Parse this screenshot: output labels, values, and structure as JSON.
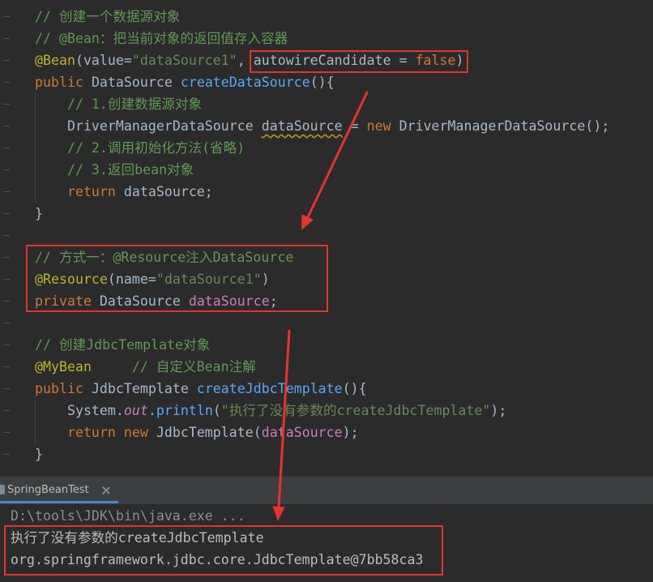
{
  "editor": {
    "lines": [
      {
        "tokens": [
          {
            "text": "// 创建一个数据源对象",
            "color": "#629755"
          }
        ]
      },
      {
        "tokens": [
          {
            "text": "// @Bean：把当前对象的返回值存入容器",
            "color": "#629755"
          }
        ]
      },
      {
        "tokens": [
          {
            "text": "@Bean",
            "color": "#BBB529"
          },
          {
            "text": "(value=",
            "color": "#A9B7C6"
          },
          {
            "text": "\"dataSource1\"",
            "color": "#6A8759"
          },
          {
            "text": ", autowireCandidate = ",
            "color": "#A9B7C6"
          },
          {
            "text": "false",
            "color": "#CC7832"
          },
          {
            "text": ")",
            "color": "#A9B7C6"
          }
        ]
      },
      {
        "tokens": [
          {
            "text": "public",
            "color": "#CC7832"
          },
          {
            "text": " DataSource ",
            "color": "#A9B7C6"
          },
          {
            "text": "createDataSource",
            "color": "#56A8F5"
          },
          {
            "text": "(){",
            "color": "#A9B7C6"
          }
        ]
      },
      {
        "tokens": [
          {
            "text": "    // 1.创建数据源对象",
            "color": "#629755"
          }
        ]
      },
      {
        "tokens": [
          {
            "text": "    DriverManagerDataSource ",
            "color": "#A9B7C6"
          },
          {
            "text": "dataSource",
            "color": "#A9B7C6",
            "wavy": true
          },
          {
            "text": " = ",
            "color": "#A9B7C6"
          },
          {
            "text": "new",
            "color": "#CC7832"
          },
          {
            "text": " DriverManagerDataSource();",
            "color": "#A9B7C6"
          }
        ]
      },
      {
        "tokens": [
          {
            "text": "    // 2.调用初始化方法(省略)",
            "color": "#629755"
          }
        ]
      },
      {
        "tokens": [
          {
            "text": "    // 3.返回bean对象",
            "color": "#629755"
          }
        ]
      },
      {
        "tokens": [
          {
            "text": "    return",
            "color": "#CC7832"
          },
          {
            "text": " dataSource;",
            "color": "#A9B7C6"
          }
        ]
      },
      {
        "tokens": [
          {
            "text": "}",
            "color": "#A9B7C6"
          }
        ]
      },
      {
        "tokens": []
      },
      {
        "tokens": [
          {
            "text": "// 方式一：@Resource注入DataSource",
            "color": "#629755"
          }
        ]
      },
      {
        "tokens": [
          {
            "text": "@Resource",
            "color": "#BBB529"
          },
          {
            "text": "(name=",
            "color": "#A9B7C6"
          },
          {
            "text": "\"dataSource1\"",
            "color": "#6A8759"
          },
          {
            "text": ")",
            "color": "#A9B7C6"
          }
        ]
      },
      {
        "tokens": [
          {
            "text": "private",
            "color": "#CC7832"
          },
          {
            "text": " DataSource ",
            "color": "#A9B7C6"
          },
          {
            "text": "dataSource",
            "color": "#C77DBB"
          },
          {
            "text": ";",
            "color": "#A9B7C6"
          }
        ]
      },
      {
        "tokens": []
      },
      {
        "tokens": [
          {
            "text": "// 创建JdbcTemplate对象",
            "color": "#629755"
          }
        ]
      },
      {
        "tokens": [
          {
            "text": "@MyBean",
            "color": "#BBB529"
          },
          {
            "text": "     // 自定义Bean注解",
            "color": "#629755"
          }
        ]
      },
      {
        "tokens": [
          {
            "text": "public",
            "color": "#CC7832"
          },
          {
            "text": " JdbcTemplate ",
            "color": "#A9B7C6"
          },
          {
            "text": "createJdbcTemplate",
            "color": "#56A8F5"
          },
          {
            "text": "(){",
            "color": "#A9B7C6"
          }
        ]
      },
      {
        "tokens": [
          {
            "text": "    System.",
            "color": "#A9B7C6"
          },
          {
            "text": "out",
            "color": "#C77DBB",
            "italic": true
          },
          {
            "text": ".",
            "color": "#A9B7C6"
          },
          {
            "text": "println",
            "color": "#56A8F5"
          },
          {
            "text": "(",
            "color": "#A9B7C6"
          },
          {
            "text": "\"执行了没有参数的createJdbcTemplate\"",
            "color": "#6A8759"
          },
          {
            "text": ");",
            "color": "#A9B7C6"
          }
        ]
      },
      {
        "tokens": [
          {
            "text": "    return new",
            "color": "#CC7832"
          },
          {
            "text": " JdbcTemplate(",
            "color": "#A9B7C6"
          },
          {
            "text": "dataSource",
            "color": "#C77DBB"
          },
          {
            "text": ");",
            "color": "#A9B7C6"
          }
        ]
      },
      {
        "tokens": [
          {
            "text": "}",
            "color": "#A9B7C6"
          }
        ]
      }
    ]
  },
  "run_panel": {
    "tab": {
      "label": "SpringBeanTest",
      "icon": "run-config-icon",
      "close_icon": "close-icon"
    },
    "console": {
      "lines": [
        {
          "text": "D:\\tools\\JDK\\bin\\java.exe ..."
        },
        {
          "text": "执行了没有参数的createJdbcTemplate"
        },
        {
          "text": "org.springframework.jdbc.core.JdbcTemplate@7bb58ca3"
        }
      ]
    }
  },
  "colors": {
    "editor_bg": "#2B2B2B",
    "gutter_mark": "#4E4E4E",
    "indent_guide": "#404040",
    "warning_underline": "#BE9117",
    "panel_border": "#323232",
    "tab_bar_bg": "#3C3F41",
    "tab_text": "#BBBBBB",
    "tab_icon": "#7D8B95",
    "close_icon": "#8C8C8C",
    "tab_underline": "#4A88C7",
    "console_bg": "#2B2B2B",
    "console_command": "#8C8C8C",
    "console_output": "#BBBBBB",
    "annotation_red": "#E8322B"
  }
}
